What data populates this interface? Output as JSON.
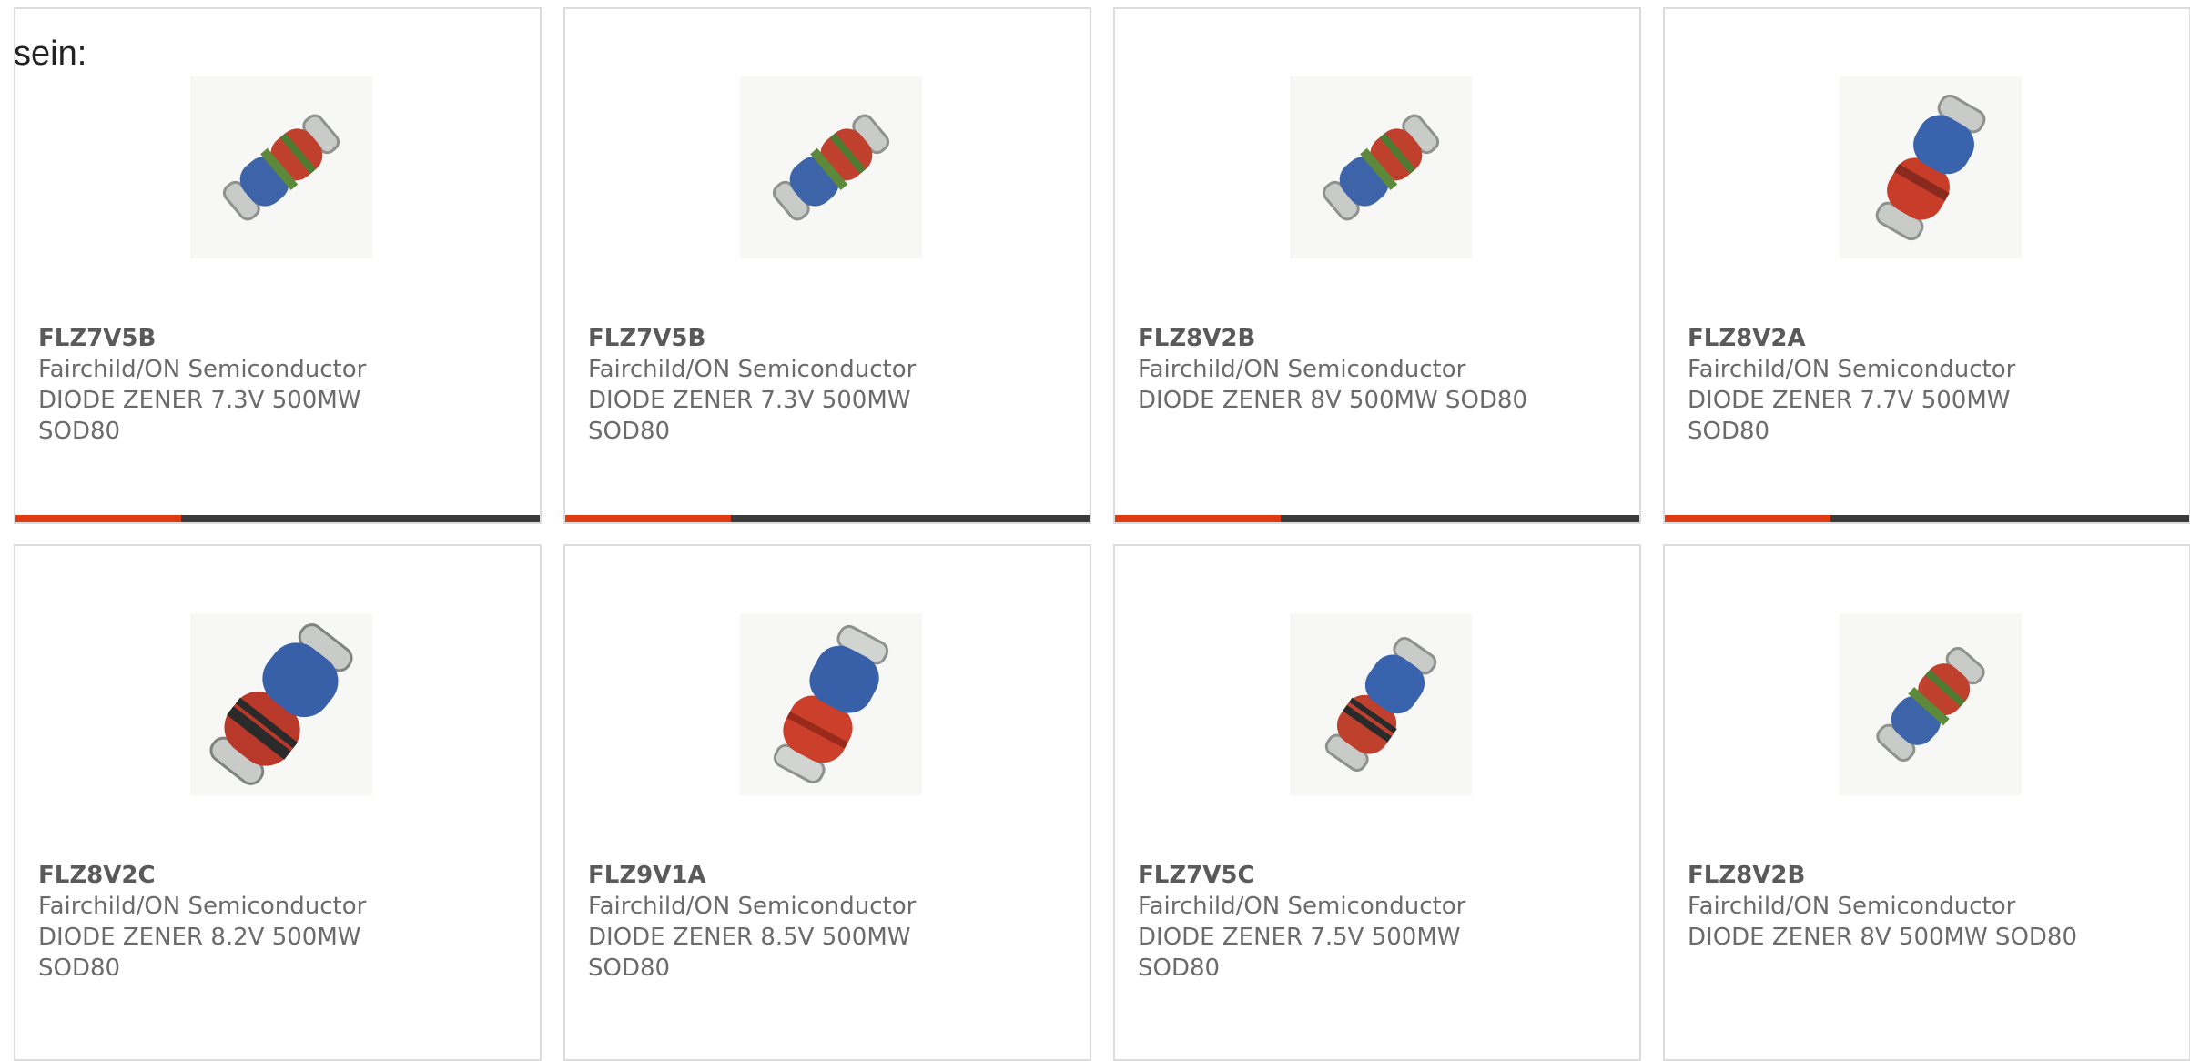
{
  "intro_text": "sein:",
  "accent_color": "#e03a12",
  "products": [
    {
      "part": "FLZ7V5B",
      "maker": "Fairchild/ON Semiconductor",
      "desc1": "DIODE ZENER 7.3V 500MW",
      "desc2": "SOD80",
      "image": "zener-diode-small-icon",
      "show_bar": true
    },
    {
      "part": "FLZ7V5B",
      "maker": "Fairchild/ON Semiconductor",
      "desc1": "DIODE ZENER 7.3V 500MW",
      "desc2": "SOD80",
      "image": "zener-diode-small-icon",
      "show_bar": true
    },
    {
      "part": "FLZ8V2B",
      "maker": "Fairchild/ON Semiconductor",
      "desc1": "DIODE ZENER 8V 500MW SOD80",
      "desc2": "",
      "image": "zener-diode-small-icon",
      "show_bar": true
    },
    {
      "part": "FLZ8V2A",
      "maker": "Fairchild/ON Semiconductor",
      "desc1": "DIODE ZENER 7.7V 500MW",
      "desc2": "SOD80",
      "image": "zener-diode-red-icon",
      "show_bar": true
    },
    {
      "part": "FLZ8V2C",
      "maker": "Fairchild/ON Semiconductor",
      "desc1": "DIODE ZENER 8.2V 500MW",
      "desc2": "SOD80",
      "image": "zener-diode-large-icon",
      "show_bar": false
    },
    {
      "part": "FLZ9V1A",
      "maker": "Fairchild/ON Semiconductor",
      "desc1": "DIODE ZENER 8.5V 500MW",
      "desc2": "SOD80",
      "image": "zener-diode-red-icon",
      "show_bar": false
    },
    {
      "part": "FLZ7V5C",
      "maker": "Fairchild/ON Semiconductor",
      "desc1": "DIODE ZENER 7.5V 500MW",
      "desc2": "SOD80",
      "image": "zener-diode-red-icon",
      "show_bar": false
    },
    {
      "part": "FLZ8V2B",
      "maker": "Fairchild/ON Semiconductor",
      "desc1": "DIODE ZENER 8V 500MW SOD80",
      "desc2": "",
      "image": "zener-diode-small-icon",
      "show_bar": false
    }
  ]
}
